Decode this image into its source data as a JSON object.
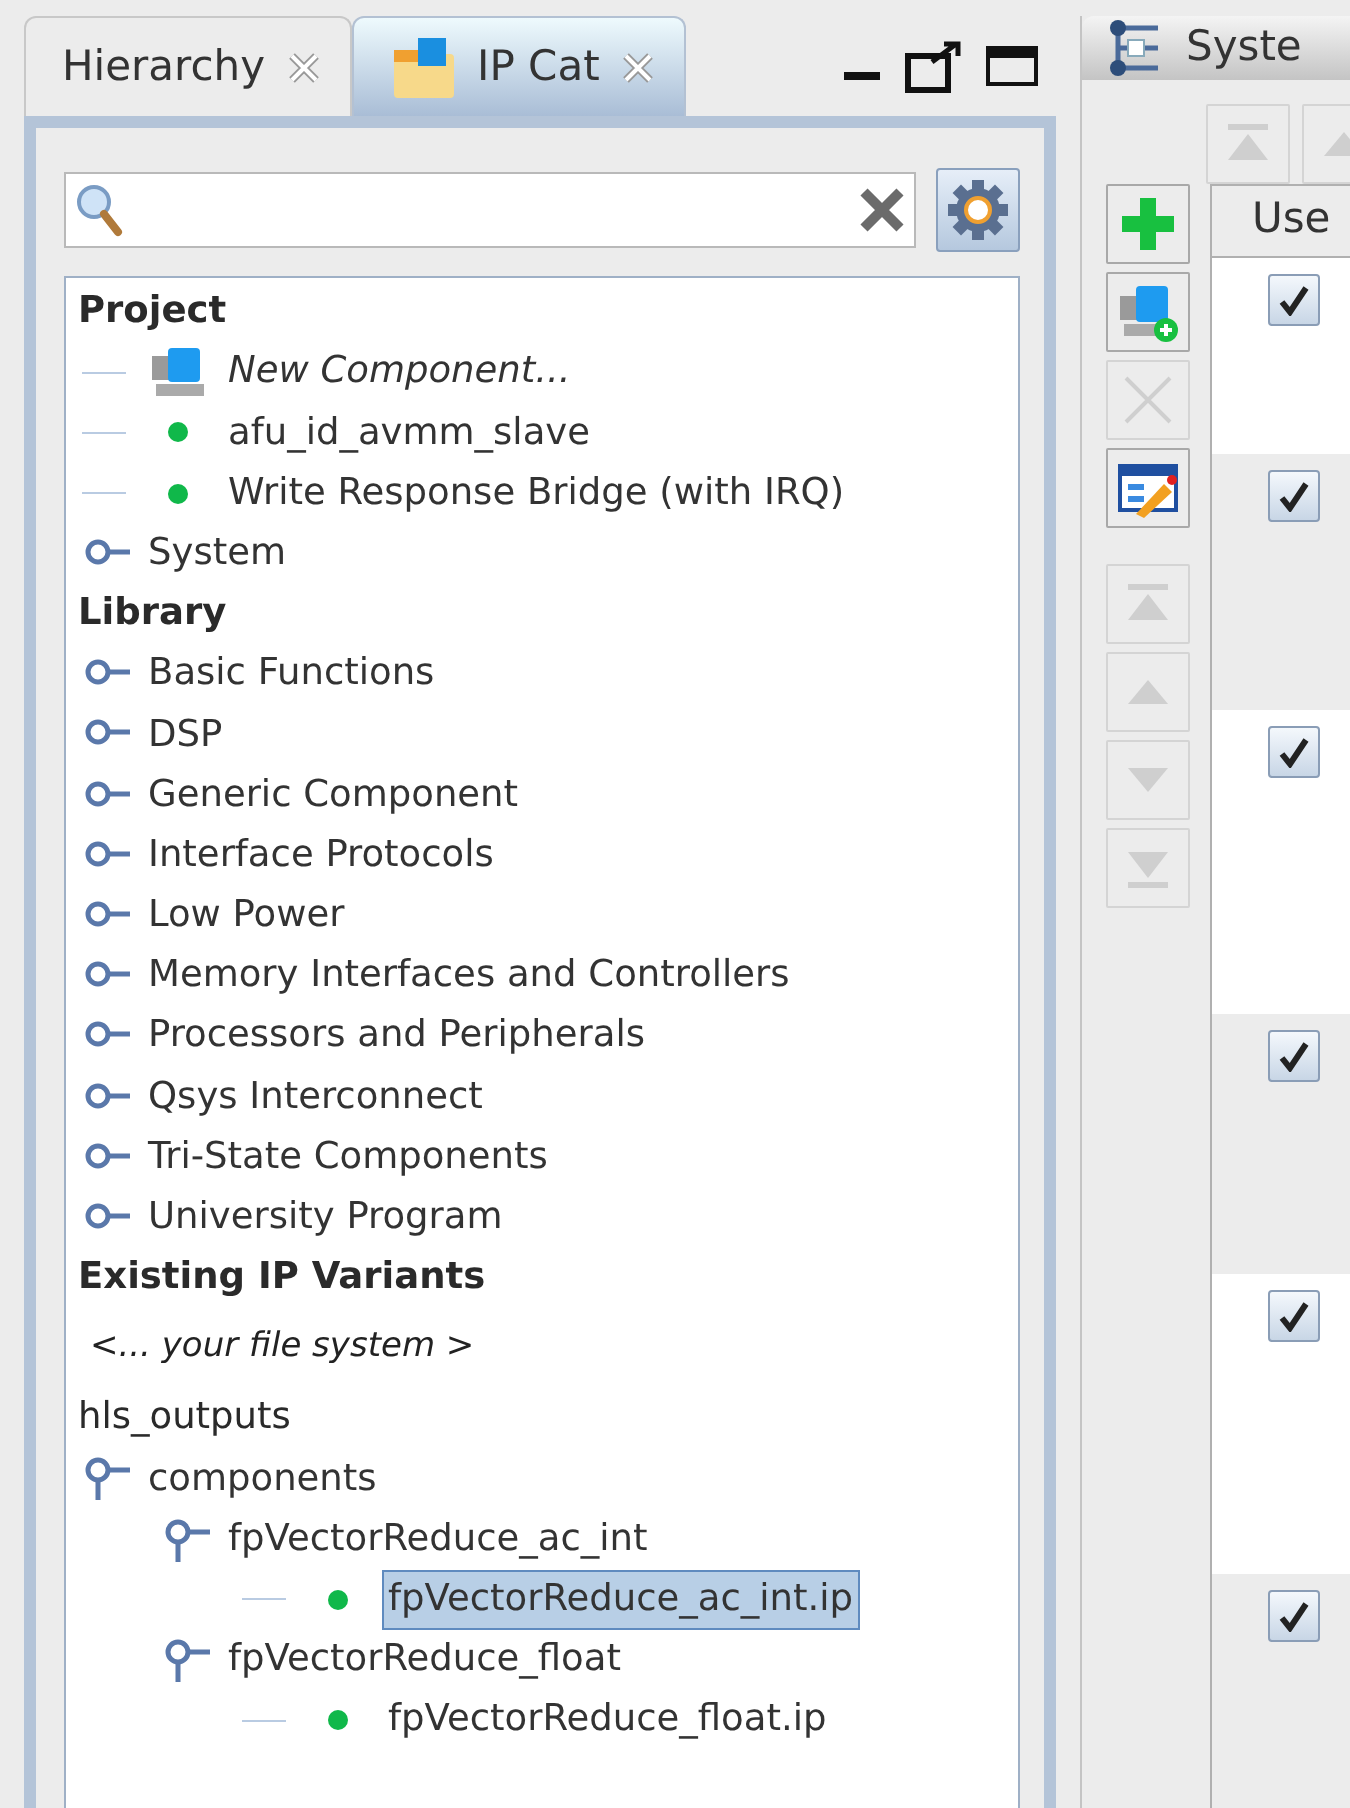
{
  "tabs": [
    {
      "label": "Hierarchy",
      "selected": false
    },
    {
      "label": "IP Cat",
      "selected": true
    }
  ],
  "tree": [
    {
      "kind": "heading",
      "label": "Project",
      "children": [
        {
          "kind": "new",
          "label": "New Component...",
          "selected": false
        },
        {
          "kind": "leaf",
          "label": "afu_id_avmm_slave",
          "selected": false
        },
        {
          "kind": "leaf",
          "label": "Write Response Bridge (with IRQ)",
          "selected": false
        },
        {
          "kind": "folder",
          "label": "System",
          "expanded": false
        }
      ]
    },
    {
      "kind": "heading",
      "label": "Library",
      "children": [
        {
          "kind": "folder",
          "label": "Basic Functions",
          "expanded": false
        },
        {
          "kind": "folder",
          "label": "DSP",
          "expanded": false
        },
        {
          "kind": "folder",
          "label": "Generic Component",
          "expanded": false
        },
        {
          "kind": "folder",
          "label": "Interface Protocols",
          "expanded": false
        },
        {
          "kind": "folder",
          "label": "Low Power",
          "expanded": false
        },
        {
          "kind": "folder",
          "label": "Memory Interfaces and Controllers",
          "expanded": false
        },
        {
          "kind": "folder",
          "label": "Processors and Peripherals",
          "expanded": false
        },
        {
          "kind": "folder",
          "label": "Qsys Interconnect",
          "expanded": false
        },
        {
          "kind": "folder",
          "label": "Tri-State Components",
          "expanded": false
        },
        {
          "kind": "folder",
          "label": "University Program",
          "expanded": false
        }
      ]
    },
    {
      "kind": "heading",
      "label": "Existing IP Variants"
    },
    {
      "kind": "link",
      "label": "<... *your file system* >"
    },
    {
      "kind": "root",
      "label": "hls_outputs",
      "children": [
        {
          "kind": "folder",
          "label": "components",
          "expanded": true,
          "children": [
            {
              "kind": "folder",
              "label": "fpVectorReduce_ac_int",
              "expanded": true,
              "children": [
                {
                  "kind": "leaf",
                  "label": "fpVectorReduce_ac_int.ip",
                  "selected": true
                }
              ]
            },
            {
              "kind": "folder",
              "label": "fpVectorReduce_float",
              "expanded": true,
              "children": [
                {
                  "kind": "leaf",
                  "label": "fpVectorReduce_float.ip",
                  "selected": false
                }
              ]
            }
          ]
        }
      ]
    }
  ],
  "system_tab": {
    "label": "Syste"
  },
  "top_toolbar": [
    {
      "kind": "top",
      "disabled": true
    },
    {
      "kind": "up",
      "disabled": true
    }
  ],
  "side_toolbar": [
    {
      "kind": "add",
      "disabled": false
    },
    {
      "kind": "add-component",
      "disabled": false
    },
    {
      "kind": "remove",
      "disabled": true
    },
    {
      "kind": "edit",
      "disabled": false
    },
    {
      "kind": "gap"
    },
    {
      "kind": "top",
      "disabled": true
    },
    {
      "kind": "up",
      "disabled": true
    },
    {
      "kind": "down",
      "disabled": true
    },
    {
      "kind": "bottom",
      "disabled": true
    }
  ],
  "table": {
    "columns": [
      "Use"
    ],
    "rows": [
      {
        "use": true
      },
      {
        "use": true
      },
      {
        "use": true
      },
      {
        "use": true
      },
      {
        "use": true
      },
      {
        "use": true
      }
    ]
  }
}
